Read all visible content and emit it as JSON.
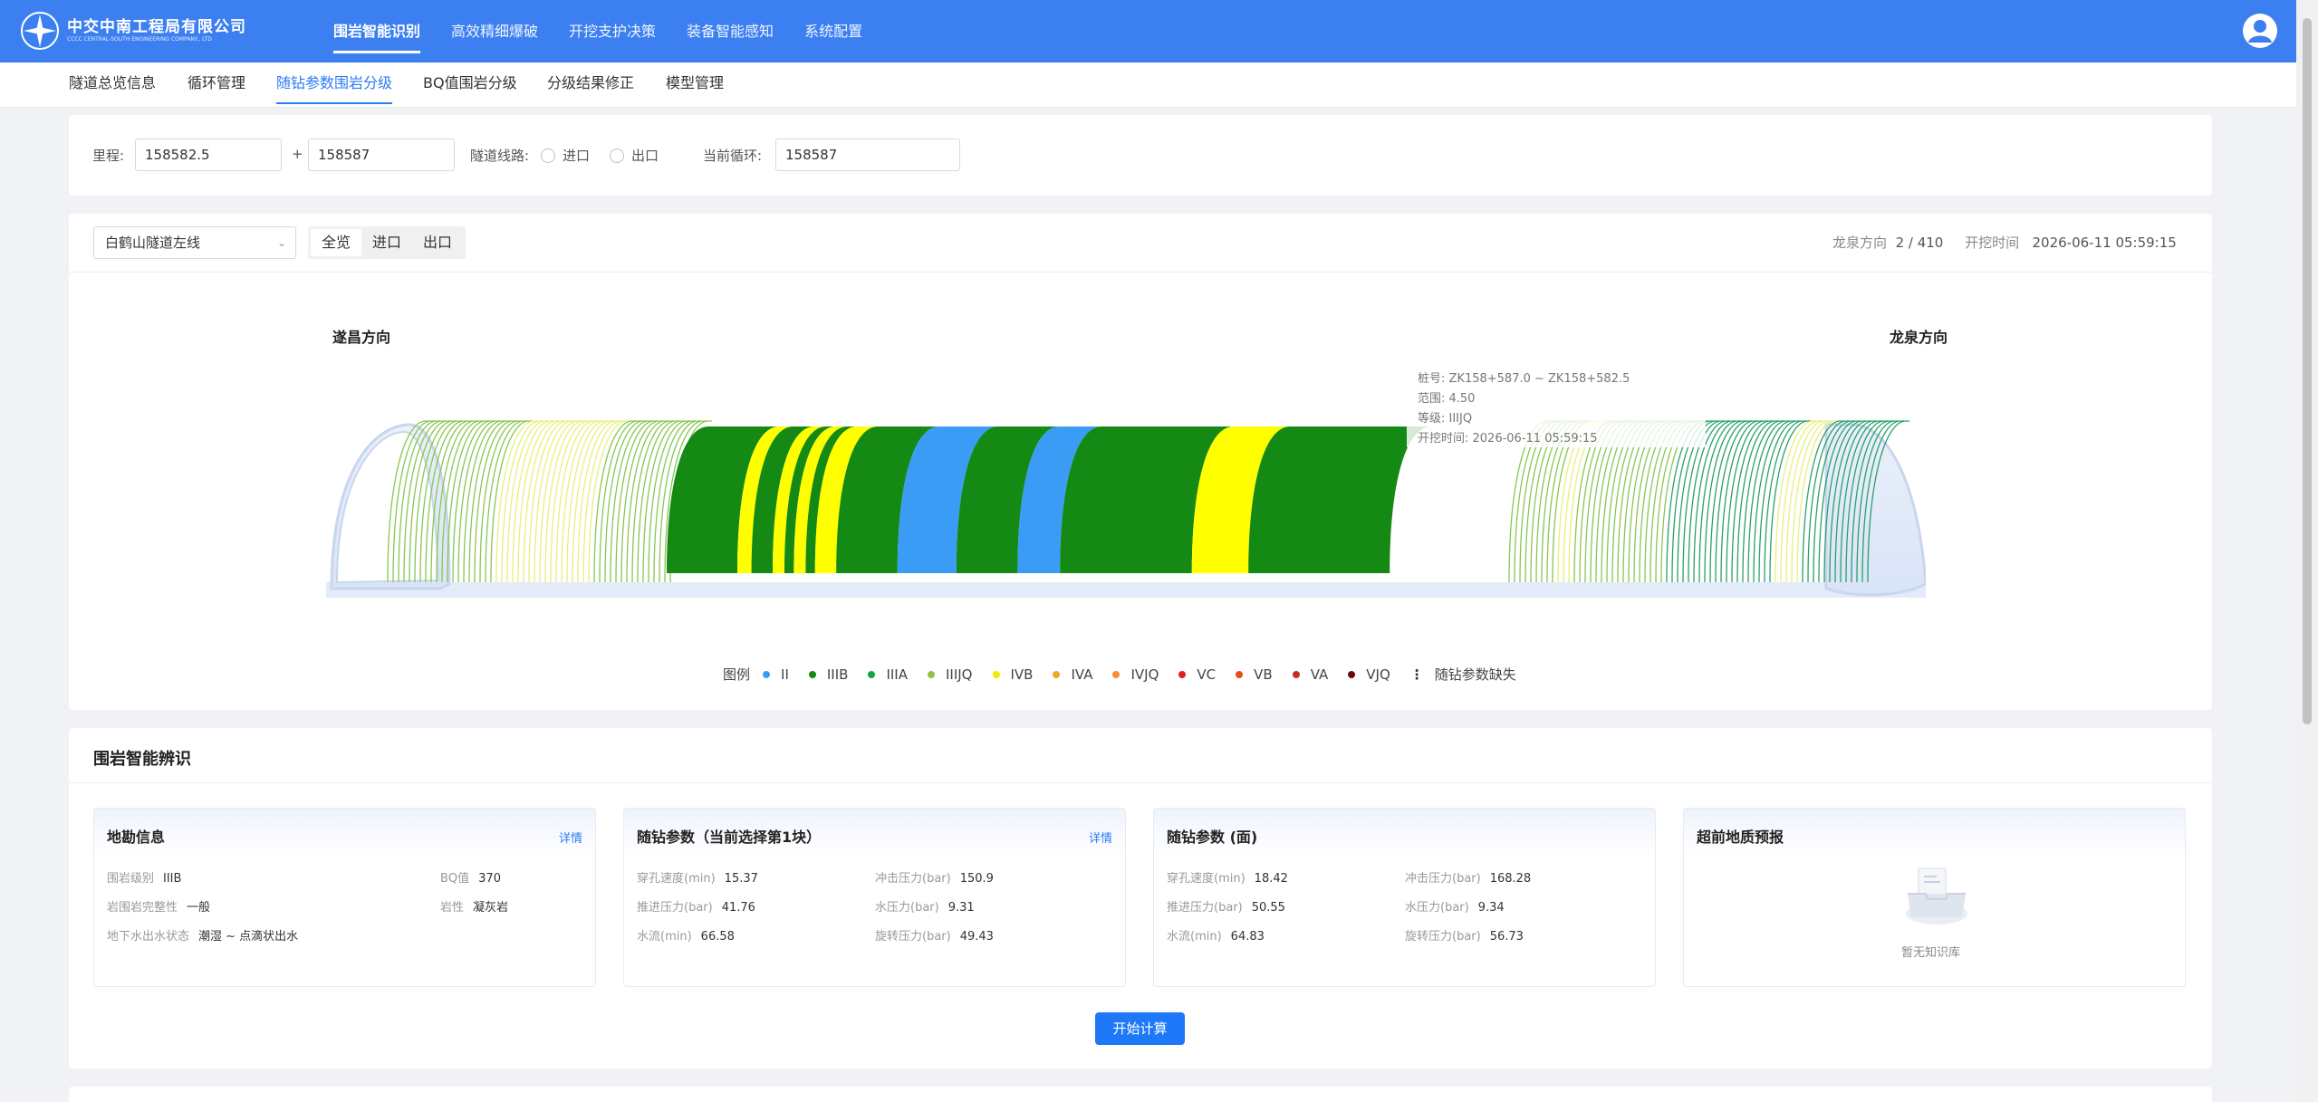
{
  "header": {
    "logo_cn": "中交中南工程局有限公司",
    "logo_en": "CCCC CENTRAL-SOUTH ENGINEERING COMPANY., LTD",
    "nav": [
      "围岩智能识别",
      "高效精细爆破",
      "开挖支护决策",
      "装备智能感知",
      "系统配置"
    ],
    "active_nav": "围岩智能识别"
  },
  "subnav": {
    "items": [
      "隧道总览信息",
      "循环管理",
      "随钻参数围岩分级",
      "BQ值围岩分级",
      "分级结果修正",
      "模型管理"
    ],
    "active": "随钻参数围岩分级"
  },
  "filter": {
    "mileage_label": "里程:",
    "mileage_start": "158582.5",
    "plus": "+",
    "mileage_end": "158587",
    "route_label": "隧道线路:",
    "route_options": [
      "进口",
      "出口"
    ],
    "cycle_label": "当前循环:",
    "cycle_value": "158587"
  },
  "tunnel": {
    "select_value": "白鹤山隧道左线",
    "view_tabs": [
      "全览",
      "进口",
      "出口"
    ],
    "active_view": "全览",
    "direction_label": "龙泉方向",
    "progress": "2 / 410",
    "dig_time_label": "开挖时间",
    "dig_time": "2026-06-11 05:59:15",
    "left_direction": "遂昌方向",
    "right_direction": "龙泉方向",
    "tooltip": {
      "pile": "桩号:  ZK158+587.0 ~ ZK158+582.5",
      "range": "范围:  4.50",
      "grade": "等级:  IIIJQ",
      "time": "开挖时间:  2026-06-11 05:59:15"
    },
    "legend_title": "图例",
    "legend": [
      {
        "name": "II",
        "color": "#3a9cf5"
      },
      {
        "name": "IIIB",
        "color": "#148a14"
      },
      {
        "name": "IIIA",
        "color": "#17a34a"
      },
      {
        "name": "IIIJQ",
        "color": "#8cc63f"
      },
      {
        "name": "IVB",
        "color": "#f4ea00"
      },
      {
        "name": "IVA",
        "color": "#f5a623"
      },
      {
        "name": "IVJQ",
        "color": "#f58c3a"
      },
      {
        "name": "VC",
        "color": "#e02020"
      },
      {
        "name": "VB",
        "color": "#e84d12"
      },
      {
        "name": "VA",
        "color": "#c62f1c"
      },
      {
        "name": "VJQ",
        "color": "#6b0a0a"
      }
    ],
    "legend_missing": "随钻参数缺失",
    "segments": [
      {
        "color": "#148a14",
        "w": 60
      },
      {
        "color": "#ffff00",
        "w": 12
      },
      {
        "color": "#148a14",
        "w": 18
      },
      {
        "color": "#ffff00",
        "w": 10
      },
      {
        "color": "#148a14",
        "w": 8
      },
      {
        "color": "#ffff00",
        "w": 10
      },
      {
        "color": "#148a14",
        "w": 8
      },
      {
        "color": "#ffff00",
        "w": 18
      },
      {
        "color": "#148a14",
        "w": 52
      },
      {
        "color": "#3a9cf5",
        "w": 50
      },
      {
        "color": "#148a14",
        "w": 52
      },
      {
        "color": "#3a9cf5",
        "w": 36
      },
      {
        "color": "#148a14",
        "w": 112
      },
      {
        "color": "#ffff00",
        "w": 48
      },
      {
        "color": "#148a14",
        "w": 120
      }
    ]
  },
  "rock": {
    "title": "围岩智能辨识",
    "detail_label": "详情",
    "survey": {
      "title": "地勘信息",
      "items": [
        {
          "k": "围岩级别",
          "v": "IIIB"
        },
        {
          "k": "BQ值",
          "v": "370"
        },
        {
          "k": "岩围岩完整性",
          "v": "一般"
        },
        {
          "k": "岩性",
          "v": "凝灰岩"
        },
        {
          "k": "地下水出水状态",
          "v": "潮湿 ~ 点滴状出水"
        }
      ]
    },
    "drill_selected": {
      "title": "随钻参数（当前选择第1块）",
      "items": [
        {
          "k": "穿孔速度(min)",
          "v": "15.37"
        },
        {
          "k": "冲击压力(bar)",
          "v": "150.9"
        },
        {
          "k": "推进压力(bar)",
          "v": "41.76"
        },
        {
          "k": "水压力(bar)",
          "v": "9.31"
        },
        {
          "k": "水流(min)",
          "v": "66.58"
        },
        {
          "k": "旋转压力(bar)",
          "v": "49.43"
        }
      ]
    },
    "drill_face": {
      "title": "随钻参数 (面)",
      "items": [
        {
          "k": "穿孔速度(min)",
          "v": "18.42"
        },
        {
          "k": "冲击压力(bar)",
          "v": "168.28"
        },
        {
          "k": "推进压力(bar)",
          "v": "50.55"
        },
        {
          "k": "水压力(bar)",
          "v": "9.34"
        },
        {
          "k": "水流(min)",
          "v": "64.83"
        },
        {
          "k": "旋转压力(bar)",
          "v": "56.73"
        }
      ]
    },
    "forecast": {
      "title": "超前地质预报",
      "empty": "暂无知识库"
    },
    "start_button": "开始计算"
  }
}
